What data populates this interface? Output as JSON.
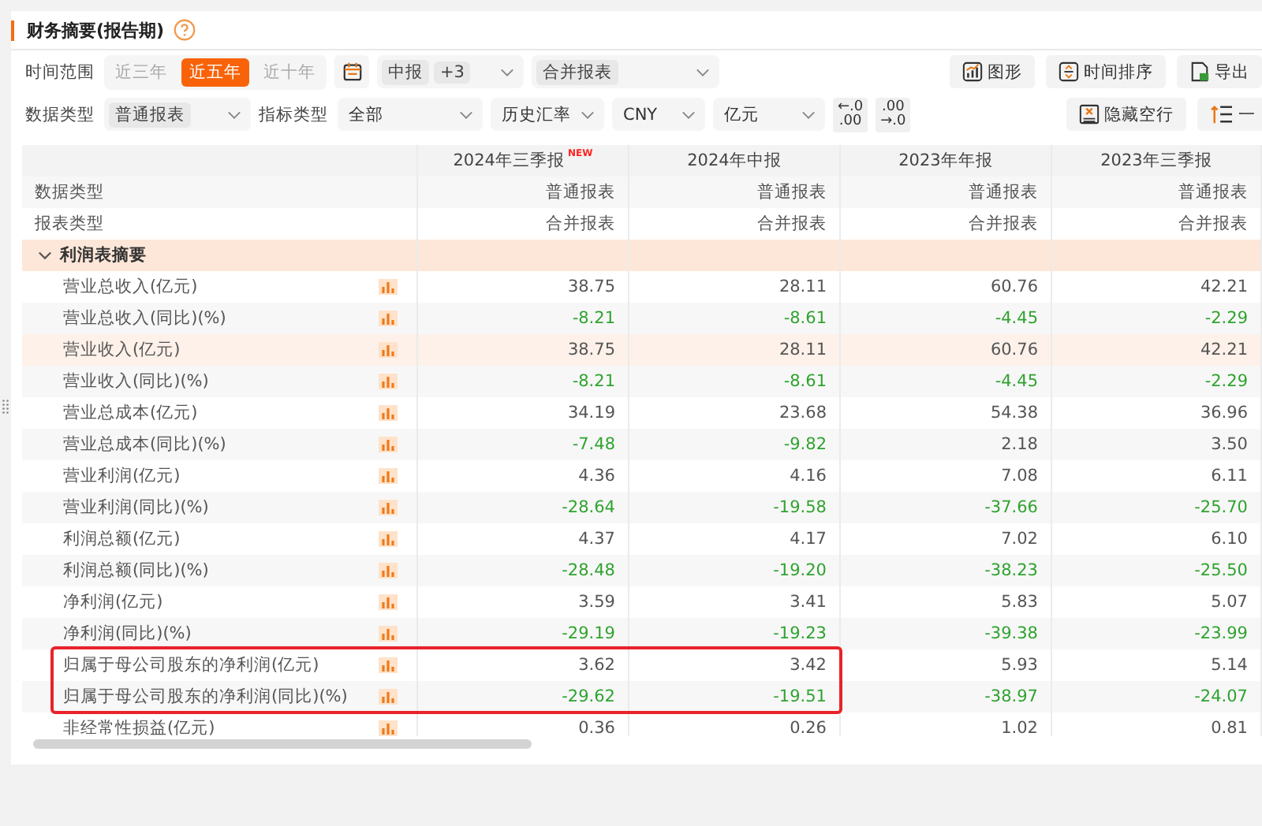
{
  "title": "财务摘要(报告期)",
  "filters_row1": {
    "label": "时间范围",
    "ranges": [
      {
        "label": "近三年",
        "selected": false
      },
      {
        "label": "近五年",
        "selected": true
      },
      {
        "label": "近十年",
        "selected": false
      }
    ],
    "period_select": {
      "chips": [
        "中报",
        "+3"
      ]
    },
    "report_select": {
      "chips": [
        "合并报表"
      ]
    }
  },
  "filters_row2": [
    {
      "kind": "label",
      "text": "数据类型"
    },
    {
      "kind": "select",
      "chip": "普通报表"
    },
    {
      "kind": "label",
      "text": "指标类型"
    },
    {
      "kind": "select",
      "text": "全部"
    },
    {
      "kind": "select",
      "text": "历史汇率"
    },
    {
      "kind": "select",
      "text": "CNY"
    },
    {
      "kind": "select",
      "text": "亿元"
    },
    {
      "kind": "decimals",
      "top": "←.0",
      "bottom": ".00"
    },
    {
      "kind": "decimals",
      "top": ".00",
      "bottom": "→.0"
    }
  ],
  "actions_row1": [
    {
      "kind": "chart",
      "label": "图形"
    },
    {
      "kind": "sort",
      "label": "时间排序"
    },
    {
      "kind": "export",
      "label": "导出"
    }
  ],
  "actions_row2": [
    {
      "kind": "hide",
      "label": "隐藏空行"
    },
    {
      "kind": "levels",
      "label": "一"
    }
  ],
  "table": {
    "columns": [
      {
        "label": "2024年三季报",
        "badge": "NEW"
      },
      {
        "label": "2024年中报"
      },
      {
        "label": "2023年年报"
      },
      {
        "label": "2023年三季报"
      }
    ],
    "rows": [
      {
        "kind": "meta",
        "label": "数据类型",
        "values": [
          {
            "value": "普通报表",
            "negative": false
          },
          {
            "value": "普通报表",
            "negative": false
          },
          {
            "value": "普通报表",
            "negative": false
          },
          {
            "value": "普通报表",
            "negative": false
          }
        ]
      },
      {
        "kind": "meta",
        "label": "报表类型",
        "values": [
          {
            "value": "合并报表",
            "negative": false
          },
          {
            "value": "合并报表",
            "negative": false
          },
          {
            "value": "合并报表",
            "negative": false
          },
          {
            "value": "合并报表",
            "negative": false
          }
        ]
      },
      {
        "kind": "section",
        "label": "利润表摘要",
        "expanded": true
      },
      {
        "kind": "item",
        "label": "营业总收入(亿元)",
        "hovered": false,
        "highlighted": false,
        "values": [
          {
            "value": "38.75",
            "negative": false
          },
          {
            "value": "28.11",
            "negative": false
          },
          {
            "value": "60.76",
            "negative": false
          },
          {
            "value": "42.21",
            "negative": false
          }
        ]
      },
      {
        "kind": "item",
        "label": "营业总收入(同比)(%)",
        "hovered": false,
        "highlighted": false,
        "values": [
          {
            "value": "-8.21",
            "negative": true
          },
          {
            "value": "-8.61",
            "negative": true
          },
          {
            "value": "-4.45",
            "negative": true
          },
          {
            "value": "-2.29",
            "negative": true
          }
        ]
      },
      {
        "kind": "item",
        "label": "营业收入(亿元)",
        "hovered": true,
        "highlighted": false,
        "values": [
          {
            "value": "38.75",
            "negative": false
          },
          {
            "value": "28.11",
            "negative": false
          },
          {
            "value": "60.76",
            "negative": false
          },
          {
            "value": "42.21",
            "negative": false
          }
        ]
      },
      {
        "kind": "item",
        "label": "营业收入(同比)(%)",
        "hovered": false,
        "highlighted": false,
        "values": [
          {
            "value": "-8.21",
            "negative": true
          },
          {
            "value": "-8.61",
            "negative": true
          },
          {
            "value": "-4.45",
            "negative": true
          },
          {
            "value": "-2.29",
            "negative": true
          }
        ]
      },
      {
        "kind": "item",
        "label": "营业总成本(亿元)",
        "hovered": false,
        "highlighted": false,
        "values": [
          {
            "value": "34.19",
            "negative": false
          },
          {
            "value": "23.68",
            "negative": false
          },
          {
            "value": "54.38",
            "negative": false
          },
          {
            "value": "36.96",
            "negative": false
          }
        ]
      },
      {
        "kind": "item",
        "label": "营业总成本(同比)(%)",
        "hovered": false,
        "highlighted": false,
        "values": [
          {
            "value": "-7.48",
            "negative": true
          },
          {
            "value": "-9.82",
            "negative": true
          },
          {
            "value": "2.18",
            "negative": false
          },
          {
            "value": "3.50",
            "negative": false
          }
        ]
      },
      {
        "kind": "item",
        "label": "营业利润(亿元)",
        "hovered": false,
        "highlighted": false,
        "values": [
          {
            "value": "4.36",
            "negative": false
          },
          {
            "value": "4.16",
            "negative": false
          },
          {
            "value": "7.08",
            "negative": false
          },
          {
            "value": "6.11",
            "negative": false
          }
        ]
      },
      {
        "kind": "item",
        "label": "营业利润(同比)(%)",
        "hovered": false,
        "highlighted": false,
        "values": [
          {
            "value": "-28.64",
            "negative": true
          },
          {
            "value": "-19.58",
            "negative": true
          },
          {
            "value": "-37.66",
            "negative": true
          },
          {
            "value": "-25.70",
            "negative": true
          }
        ]
      },
      {
        "kind": "item",
        "label": "利润总额(亿元)",
        "hovered": false,
        "highlighted": false,
        "values": [
          {
            "value": "4.37",
            "negative": false
          },
          {
            "value": "4.17",
            "negative": false
          },
          {
            "value": "7.02",
            "negative": false
          },
          {
            "value": "6.10",
            "negative": false
          }
        ]
      },
      {
        "kind": "item",
        "label": "利润总额(同比)(%)",
        "hovered": false,
        "highlighted": false,
        "values": [
          {
            "value": "-28.48",
            "negative": true
          },
          {
            "value": "-19.20",
            "negative": true
          },
          {
            "value": "-38.23",
            "negative": true
          },
          {
            "value": "-25.50",
            "negative": true
          }
        ]
      },
      {
        "kind": "item",
        "label": "净利润(亿元)",
        "hovered": false,
        "highlighted": false,
        "values": [
          {
            "value": "3.59",
            "negative": false
          },
          {
            "value": "3.41",
            "negative": false
          },
          {
            "value": "5.83",
            "negative": false
          },
          {
            "value": "5.07",
            "negative": false
          }
        ]
      },
      {
        "kind": "item",
        "label": "净利润(同比)(%)",
        "hovered": false,
        "highlighted": false,
        "values": [
          {
            "value": "-29.19",
            "negative": true
          },
          {
            "value": "-19.23",
            "negative": true
          },
          {
            "value": "-39.38",
            "negative": true
          },
          {
            "value": "-23.99",
            "negative": true
          }
        ]
      },
      {
        "kind": "item",
        "label": "归属于母公司股东的净利润(亿元)",
        "hovered": false,
        "highlighted": true,
        "values": [
          {
            "value": "3.62",
            "negative": false
          },
          {
            "value": "3.42",
            "negative": false
          },
          {
            "value": "5.93",
            "negative": false
          },
          {
            "value": "5.14",
            "negative": false
          }
        ]
      },
      {
        "kind": "item",
        "label": "归属于母公司股东的净利润(同比)(%)",
        "hovered": false,
        "highlighted": true,
        "values": [
          {
            "value": "-29.62",
            "negative": true
          },
          {
            "value": "-19.51",
            "negative": true
          },
          {
            "value": "-38.97",
            "negative": true
          },
          {
            "value": "-24.07",
            "negative": true
          }
        ]
      },
      {
        "kind": "item",
        "label": "非经常性损益(亿元)",
        "hovered": false,
        "highlighted": false,
        "values": [
          {
            "value": "0.36",
            "negative": false
          },
          {
            "value": "0.26",
            "negative": false
          },
          {
            "value": "1.02",
            "negative": false
          },
          {
            "value": "0.81",
            "negative": false
          }
        ]
      }
    ]
  }
}
